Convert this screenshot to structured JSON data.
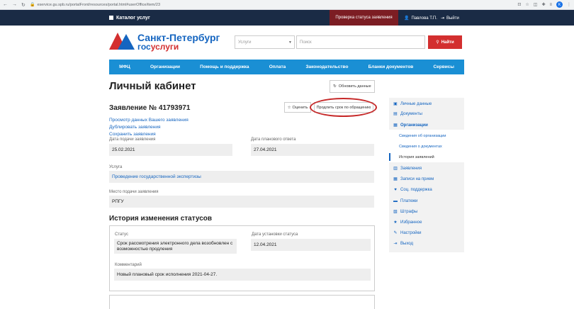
{
  "browser": {
    "url": "eservice.gu.spb.ru/portalFront/resources/portal.html#userOffice/item/23",
    "avatar_letter": "K"
  },
  "topbar": {
    "catalog_label": "Каталог услуг",
    "status_check_label": "Проверка статуса заявления",
    "user_name": "Павлова Т.П.",
    "logout_label": "Выйти"
  },
  "logo": {
    "line1": "Санкт-Петербург",
    "line2_a": "гос",
    "line2_b": "услуги"
  },
  "search": {
    "select_value": "Услуги",
    "input_placeholder": "Поиск",
    "button_label": "Найти"
  },
  "nav": [
    "МФЦ",
    "Организации",
    "Помощь и поддержка",
    "Оплата",
    "Законодательство",
    "Бланки документов",
    "Сервисы"
  ],
  "page": {
    "title": "Личный кабинет",
    "refresh_label": "Обновить данные",
    "application_title": "Заявление № 41793971",
    "rate_label": "Оценить",
    "extend_label": "Продлить срок по обращению",
    "links": [
      "Просмотр данных Вашего заявления",
      "Дублировать заявления",
      "Сохранить заявления"
    ],
    "submit_date_label": "Дата подачи заявления",
    "submit_date": "25.02.2021",
    "planned_date_label": "Дата планового ответа",
    "planned_date": "27.04.2021",
    "service_label": "Услуга",
    "service_value": "Проведение государственной экспертизы",
    "place_label": "Место подачи заявления",
    "place_value": "РПГУ",
    "history_title": "История изменения статусов",
    "status_label": "Статус",
    "status_value_1": "Срок рассмотрения электронного дела возобновлен с",
    "status_value_2": "возможностью продления",
    "status_date_label": "Дата установки статуса",
    "status_date": "12.04.2021",
    "comment_label": "Комментарий",
    "comment_value": "Новый плановый срок исполнения 2021-04-27."
  },
  "sidebar": {
    "personal": "Личные данные",
    "documents": "Документы",
    "organizations": "Организации",
    "sub_org_info": "Сведения об организации",
    "sub_docs_info": "Сведения о документах",
    "sub_history": "История заявлений",
    "applications": "Заявления",
    "appointments": "Записи на прием",
    "support": "Соц. поддержка",
    "payments": "Платежи",
    "fines": "Штрафы",
    "favorites": "Избранное",
    "settings": "Настройки",
    "logout": "Выход"
  }
}
